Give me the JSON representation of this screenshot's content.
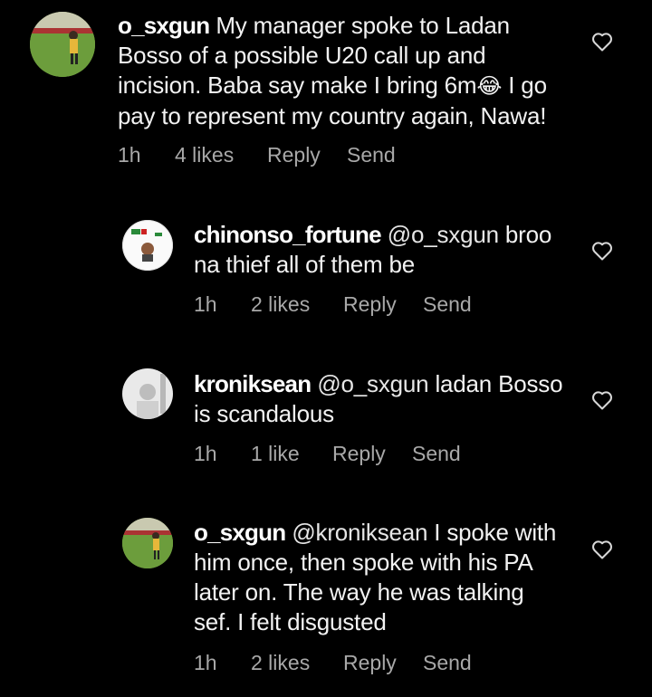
{
  "comments": [
    {
      "username": "o_sxgun",
      "mention": "",
      "text_line1": "My manager spoke to Ladan",
      "text_line2": "Bosso of a possible U20 call up and",
      "text_line3a": "incision. Baba say make I bring 6m",
      "emoji": "😂",
      "text_line3b": " I go",
      "text_line4": "pay to represent my country again, Nawa!",
      "time": "1h",
      "likes": "4 likes",
      "reply": "Reply",
      "send": "Send"
    },
    {
      "username": "chinonso_fortune",
      "mention": "@o_sxgun",
      "text_line1": " broo",
      "text_line2": "na thief all of them be",
      "time": "1h",
      "likes": "2 likes",
      "reply": "Reply",
      "send": "Send"
    },
    {
      "username": "kroniksean",
      "mention": "@o_sxgun",
      "text_line1": " ladan Bosso",
      "text_line2": "is scandalous",
      "time": "1h",
      "likes": "1 like",
      "reply": "Reply",
      "send": "Send"
    },
    {
      "username": "o_sxgun",
      "mention": "@kroniksean",
      "text_line1": " I spoke with",
      "text_line2": "him once, then spoke with his PA",
      "text_line3": "later on. The way he was talking",
      "text_line4": "sef. I felt disgusted",
      "time": "1h",
      "likes": "2 likes",
      "reply": "Reply",
      "send": "Send"
    }
  ],
  "icons": {
    "like": "heart-outline-icon"
  },
  "colors": {
    "background": "#000000",
    "meta": "#a8a8a8",
    "text": "#f2f2f2"
  }
}
